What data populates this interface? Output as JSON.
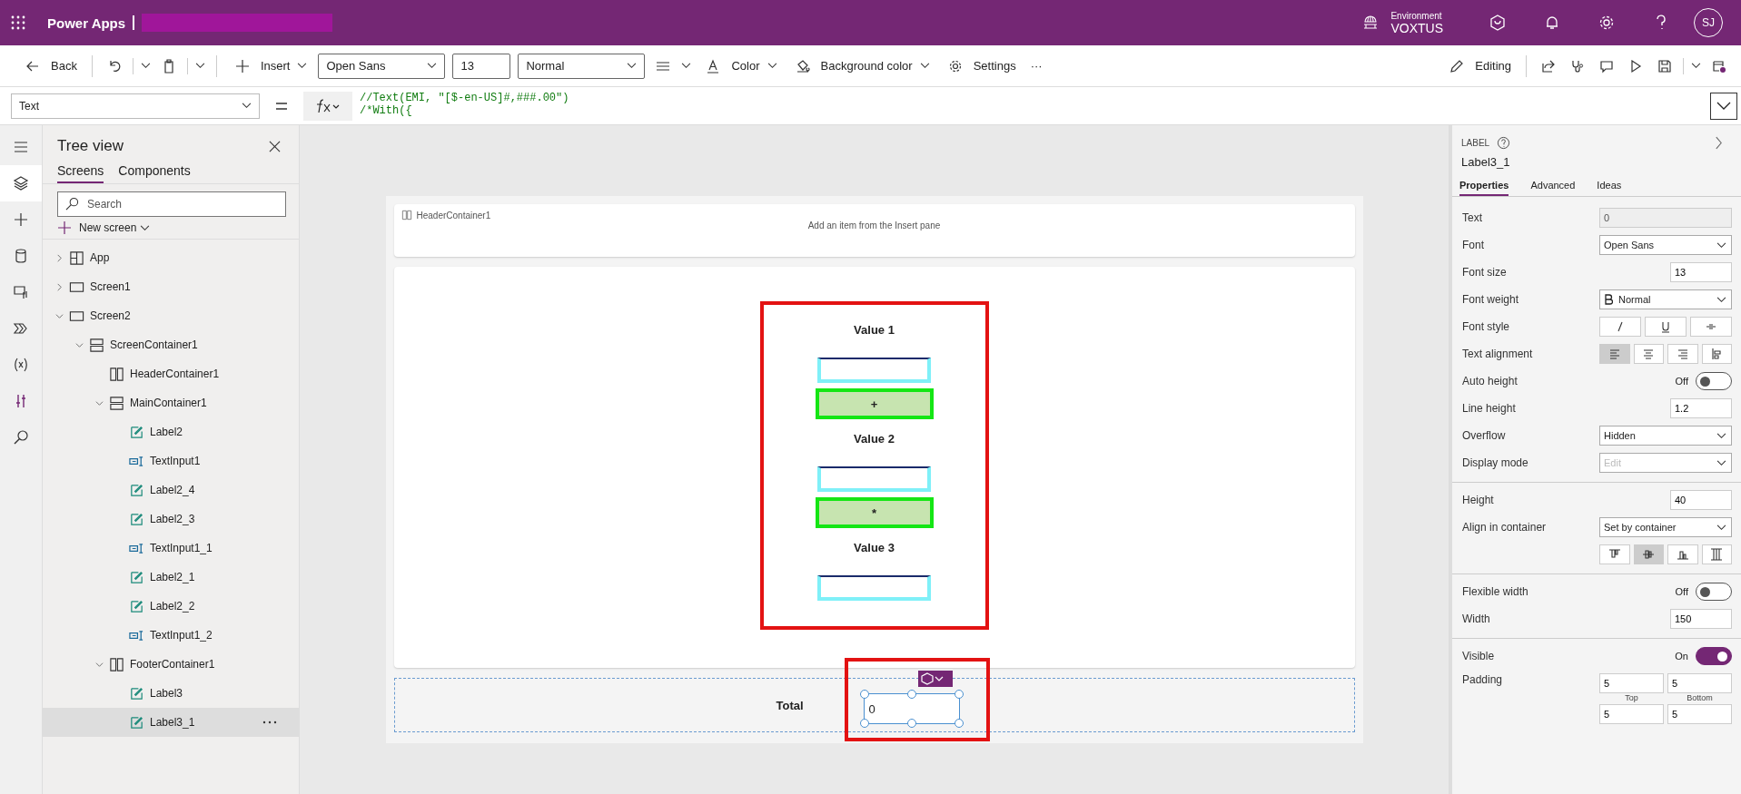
{
  "header": {
    "app_name": "Power Apps",
    "environment_label": "Environment",
    "environment_name": "VOXTUS",
    "avatar": "SJ"
  },
  "toolbar": {
    "back": "Back",
    "insert": "Insert",
    "font": "Open Sans",
    "font_size": "13",
    "font_weight": "Normal",
    "tint": "Color",
    "fill": "Background color",
    "settings": "Settings",
    "more": "···",
    "editing": "Editing"
  },
  "formula_bar": {
    "property": "Text",
    "lines": [
      "//Text(EMI, \"[$-en-US]#,###.00\")",
      "/*With({"
    ]
  },
  "tree_view": {
    "title": "Tree view",
    "tabs": [
      {
        "label": "Screens",
        "selected": true
      },
      {
        "label": "Components",
        "selected": false
      }
    ],
    "search": {
      "placeholder": "Search"
    },
    "new_screen": "New screen",
    "items": [
      {
        "label": "App",
        "kind": "app",
        "expanded": false,
        "selected": false
      },
      {
        "label": "Screen1",
        "kind": "screen",
        "expanded": false,
        "selected": false
      },
      {
        "label": "Screen2",
        "kind": "screen",
        "expanded": true,
        "selected": false,
        "children": [
          {
            "label": "ScreenContainer1",
            "kind": "vcontainer",
            "expanded": true,
            "selected": false,
            "children": [
              {
                "label": "HeaderContainer1",
                "kind": "hcontainer",
                "selected": false
              },
              {
                "label": "MainContainer1",
                "kind": "vcontainer",
                "expanded": true,
                "selected": false,
                "children": [
                  {
                    "label": "Label2",
                    "kind": "label",
                    "selected": false
                  },
                  {
                    "label": "TextInput1",
                    "kind": "textinput",
                    "selected": false
                  },
                  {
                    "label": "Label2_4",
                    "kind": "label",
                    "selected": false
                  },
                  {
                    "label": "Label2_3",
                    "kind": "label",
                    "selected": false
                  },
                  {
                    "label": "TextInput1_1",
                    "kind": "textinput",
                    "selected": false
                  },
                  {
                    "label": "Label2_1",
                    "kind": "label",
                    "selected": false
                  },
                  {
                    "label": "Label2_2",
                    "kind": "label",
                    "selected": false
                  },
                  {
                    "label": "TextInput1_2",
                    "kind": "textinput",
                    "selected": false
                  }
                ]
              },
              {
                "label": "FooterContainer1",
                "kind": "hcontainer",
                "expanded": true,
                "selected": false,
                "children": [
                  {
                    "label": "Label3",
                    "kind": "label",
                    "selected": false
                  },
                  {
                    "label": "Label3_1",
                    "kind": "label",
                    "selected": true
                  }
                ]
              }
            ]
          }
        ]
      }
    ]
  },
  "canvas": {
    "header_container": {
      "name": "HeaderContainer1",
      "hint": "Add an item from the Insert pane"
    },
    "main_items": [
      {
        "kind": "label",
        "text": "Value 1"
      },
      {
        "kind": "input"
      },
      {
        "kind": "button",
        "text": "+"
      },
      {
        "kind": "label",
        "text": "Value 2"
      },
      {
        "kind": "input"
      },
      {
        "kind": "button",
        "text": "*"
      },
      {
        "kind": "label",
        "text": "Value 3"
      },
      {
        "kind": "input"
      }
    ],
    "footer": {
      "label": "Total",
      "value": "0"
    }
  },
  "properties": {
    "type": "LABEL",
    "name": "Label3_1",
    "tabs": [
      {
        "label": "Properties",
        "selected": true
      },
      {
        "label": "Advanced",
        "selected": false
      },
      {
        "label": "Ideas",
        "selected": false
      }
    ],
    "sections": [
      [
        {
          "kind": "readonly",
          "label": "Text",
          "value": "0"
        },
        {
          "kind": "dropdown",
          "label": "Font",
          "value": "Open Sans",
          "disabled": false
        },
        {
          "kind": "number",
          "label": "Font size",
          "value": "13"
        },
        {
          "kind": "weight",
          "label": "Font weight",
          "value": "Normal"
        },
        {
          "kind": "style-buttons",
          "label": "Font style",
          "options": [
            {
              "selected": false
            },
            {
              "selected": false
            },
            {
              "selected": false
            }
          ]
        },
        {
          "kind": "align-buttons",
          "label": "Text alignment",
          "options": [
            {
              "selected": true
            },
            {
              "selected": false
            },
            {
              "selected": false
            },
            {
              "selected": false
            }
          ]
        },
        {
          "kind": "toggle",
          "label": "Auto height",
          "value": "Off",
          "on": false
        },
        {
          "kind": "number",
          "label": "Line height",
          "value": "1.2"
        },
        {
          "kind": "dropdown",
          "label": "Overflow",
          "value": "Hidden",
          "disabled": false
        },
        {
          "kind": "dropdown",
          "label": "Display mode",
          "value": "Edit",
          "disabled": true
        }
      ],
      [
        {
          "kind": "number",
          "label": "Height",
          "value": "40"
        },
        {
          "kind": "dropdown",
          "label": "Align in container",
          "value": "Set by container",
          "disabled": false
        },
        {
          "kind": "position-buttons",
          "options": [
            {
              "selected": false
            },
            {
              "selected": true
            },
            {
              "selected": false
            },
            {
              "selected": false
            }
          ]
        }
      ],
      [
        {
          "kind": "toggle",
          "label": "Flexible width",
          "value": "Off",
          "on": false
        },
        {
          "kind": "number",
          "label": "Width",
          "value": "150"
        }
      ],
      [
        {
          "kind": "toggle",
          "label": "Visible",
          "value": "On",
          "on": true
        },
        {
          "kind": "padding",
          "label": "Padding",
          "values": [
            "5",
            "5",
            "5",
            "5"
          ],
          "captions": [
            "Top",
            "Bottom"
          ]
        }
      ]
    ]
  }
}
